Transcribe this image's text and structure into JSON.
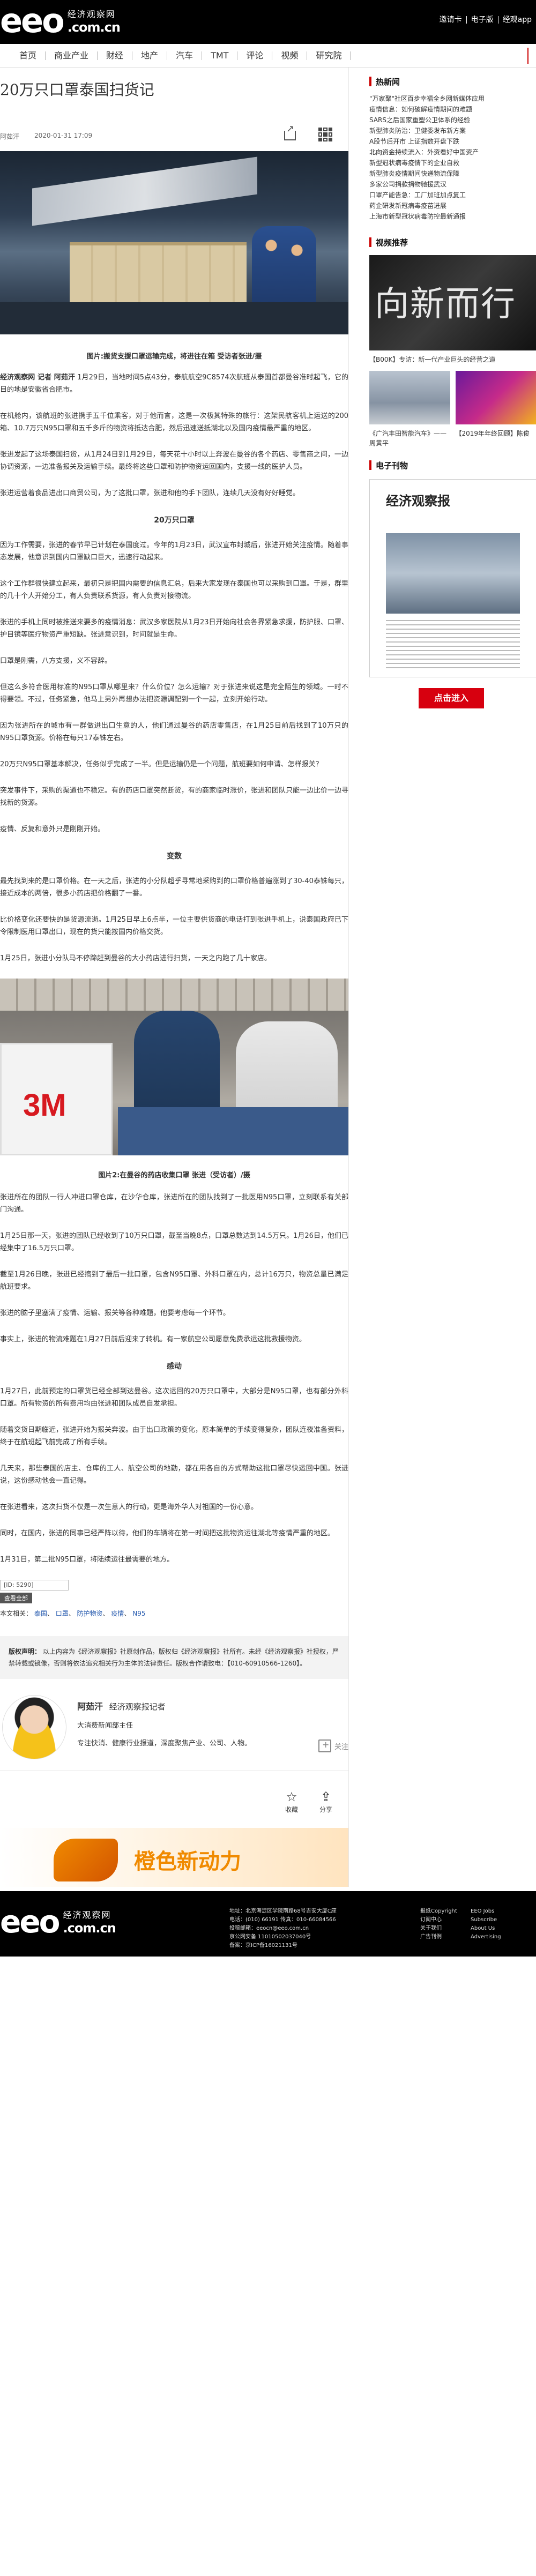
{
  "header": {
    "logo_eeo": "eeo",
    "logo_cn": "经济观察网",
    "logo_domain": ".com.cn",
    "top_links": [
      "邀请卡",
      "电子版",
      "经观app"
    ]
  },
  "nav": [
    "首页",
    "商业产业",
    "财经",
    "地产",
    "汽车",
    "TMT",
    "评论",
    "视频",
    "研究院"
  ],
  "article": {
    "title": "20万只口罩泰国扫货记",
    "author": "阿茹汗",
    "date": "2020-01-31 17:09",
    "caption1": "图片:搬货支援口罩运输完成，将进往在箱 受访者张进/摄",
    "paras1": [
      [
        "经济观察网 记者 阿茹汗",
        " 1月29日，当地时间5点43分，泰航航空9C8574次航班从泰国首都曼谷准时起飞，它的目的地是安徽省合肥市。"
      ],
      [
        "",
        "在机舱内，该航班的张进携手五千位乘客，对于他而言，这是一次极其特殊的旅行：这架民航客机上运送的200箱、10.7万只N95口罩和五千多斤的物资将抵达合肥，然后迅速送抵湖北以及国内疫情最严重的地区。"
      ],
      [
        "",
        "张进发起了这场泰国扫货，从1月24日到1月29日，每天花十小时以上奔波在曼谷的各个药店、零售商之间，一边协调资源，一边准备报关及运输手续。最终将这些口罩和防护物资运回国内，支援一线的医护人员。"
      ],
      [
        "",
        "张进运营着食品进出口商贸公司，为了这批口罩，张进和他的手下团队，连续几天没有好好睡觉。"
      ]
    ],
    "head1": "20万只口罩",
    "paras2": [
      [
        "",
        "因为工作需要，张进的春节早已计划在泰国度过。今年的1月23日，武汉宣布封城后，张进开始关注疫情。随着事态发展，他意识到国内口罩缺口巨大，迅速行动起来。"
      ],
      [
        "",
        "这个工作群很快建立起来，最初只是把国内需要的信息汇总，后来大家发现在泰国也可以采购到口罩。于是，群里的几十个人开始分工，有人负责联系货源，有人负责对接物流。"
      ],
      [
        "",
        "张进的手机上同时被推送来要多的疫情消息：武汉多家医院从1月23日开始向社会各界紧急求援，防护服、口罩、护目镜等医疗物资严重短缺。张进意识到，时间就是生命。"
      ],
      [
        "",
        "口罩是刚需，八方支援，义不容辞。"
      ],
      [
        "",
        "但这么多符合医用标准的N95口罩从哪里来？什么价位？怎么运输？对于张进来说这是完全陌生的领域。一时不得要领。不过，任务紧急，他马上另外再想办法把资源调配到一个一起，立刻开始行动。"
      ],
      [
        "",
        "因为张进所在的城市有一群做进出口生意的人，他们通过曼谷的药店零售店，在1月25日前后找到了10万只的N95口罩货源。价格在每只17泰铢左右。"
      ],
      [
        "",
        "20万只N95口罩基本解决，任务似乎完成了一半。但是运输仍是一个问题，航班要如何申请、怎样报关？"
      ],
      [
        "",
        "突发事件下，采购的渠道也不稳定。有的药店口罩突然断货，有的商家临时涨价，张进和团队只能一边比价一边寻找新的货源。"
      ],
      [
        "",
        "疫情、反复和意外只是刚刚开始。"
      ]
    ],
    "head2": "变数",
    "paras3": [
      [
        "",
        "最先找到来的是口罩价格。在一天之后，张进的小分队超乎寻常地采购到的口罩价格普遍涨到了30-40泰铢每只，接近成本的两倍，很多小药店把价格翻了一番。"
      ],
      [
        "",
        "比价格变化还要快的是货源流逝。1月25日早上6点半，一位主要供货商的电话打到张进手机上，说泰国政府已下令限制医用口罩出口，现在的货只能按国内价格交货。"
      ],
      [
        "",
        "1月25日，张进小分队马不停蹄赶到曼谷的大小药店进行扫货，一天之内跑了几十家店。"
      ]
    ],
    "caption2": "图片2:在曼谷的药店收集口罩 张进（受访者）/摄",
    "paras4": [
      [
        "",
        "张进所在的团队一行人冲进口罩仓库，在沙华仓库，张进所在的团队找到了一批医用N95口罩，立刻联系有关部门沟通。"
      ],
      [
        "",
        "1月25日那一天，张进的团队已经收到了10万只口罩，截至当晚8点，口罩总数达到14.5万只。1月26日，他们已经集中了16.5万只口罩。"
      ],
      [
        "",
        "截至1月26日晚，张进已经搞到了最后一批口罩，包含N95口罩、外科口罩在内，总计16万只，物资总量已满足航班要求。"
      ],
      [
        "",
        "张进的脑子里塞满了疫情、运输、报关等各种难题，他要考虑每一个环节。"
      ],
      [
        "",
        "事实上，张进的物流难题在1月27日前后迎来了转机。有一家航空公司愿意免费承运这批救援物资。"
      ]
    ],
    "head3": "感动",
    "paras5": [
      [
        "",
        "1月27日，此前预定的口罩货已经全部到达曼谷。这次运回的20万只口罩中，大部分是N95口罩，也有部分外科口罩。所有物资的所有费用均由张进和团队成员自发承担。"
      ],
      [
        "",
        "随着交货日期临近，张进开始为报关奔波。由于出口政策的变化，原本简单的手续变得复杂，团队连夜准备资料，终于在航班起飞前完成了所有手续。"
      ],
      [
        "",
        "几天来，那些泰国的店主、仓库的工人、航空公司的地勤，都在用各自的方式帮助这批口罩尽快运回中国。张进说，这份感动他会一直记得。"
      ],
      [
        "",
        "在张进看来，这次扫货不仅是一次生意人的行动，更是海外华人对祖国的一份心意。"
      ],
      [
        "",
        "同时，在国内，张进的同事已经严阵以待，他们的车辆将在第一时间把这批物资运往湖北等疫情严重的地区。"
      ],
      [
        "",
        "1月31日，第二批N95口罩，将陆续运往最需要的地方。"
      ]
    ],
    "source_box": "[ID: 5290]",
    "more_btn": "查看全部",
    "tags_prefix": "本文相关：",
    "tags": [
      "泰国",
      "口罩",
      "防护物资",
      "疫情",
      "N95"
    ],
    "copyright_title": "版权声明：",
    "copyright_text": "以上内容为《经济观察报》社原创作品，版权归《经济观察报》社所有。未经《经济观察报》社授权，严禁转载或镜像，否则将依法追究相关行为主体的法律责任。版权合作请致电：【010-60910566-1260】。"
  },
  "author_card": {
    "name": "阿茹汗",
    "role": "经济观察报记者",
    "line1": "大消费新闻部主任",
    "line2": "专注快消、健康行业报道，深度聚焦产业、公司、人物。",
    "follow": "关注"
  },
  "actions": {
    "save": "收藏",
    "share": "分享"
  },
  "banner_text": "橙色新动力",
  "sidebar": {
    "hot_title": "热新闻",
    "hot_items": [
      "\"万家聚\"社区百步幸福全乡网新媒体应用",
      "疫情信息：如何破解疫情期间的难题",
      "SARS之后国家重塑公卫体系的经验",
      "新型肺炎防治：卫健委发布新方案",
      "A股节后开市 上证指数开盘下跌",
      "北向资金持续流入：外资看好中国资产",
      "新型冠状病毒疫情下的企业自救",
      "新型肺炎疫情期间快递物流保障",
      "多家公司捐款捐物驰援武汉",
      "口罩产能告急：工厂加班加点复工",
      "药企研发新冠病毒疫苗进展",
      "上海市新型冠状病毒防控最新通报"
    ],
    "video_title": "视频推荐",
    "video_main_text": "向新而行",
    "video_main_cap": "【B00K】专访：新一代产业巨头的经营之道",
    "video_small": [
      {
        "cap": "",
        "text": "《广汽丰田智能汽车》——周黄平"
      },
      {
        "cap": "",
        "text": "【2019年年终回顾】陈俊"
      }
    ],
    "epaper_title": "电子刊物",
    "epaper_masthead": "经济观察报",
    "join_btn": "点击进入"
  },
  "footer": {
    "logo_eeo": "eeo",
    "logo_cn": "经济观察网",
    "logo_domain": ".com.cn",
    "mid_lines": [
      "地址：北京海淀区学院南路68号吉安大厦C座",
      "电话：(010) 66191 传真：010-66084566",
      "投稿邮箱：eeocn@eeo.com.cn",
      "京公网安备 11010502037040号",
      "备案：京ICP备16021131号"
    ],
    "right_links": [
      "报纸Copyright",
      "EEO Jobs",
      "订阅中心",
      "Subscribe",
      "关于我们",
      "About Us",
      "广告刊例",
      "Advertising"
    ]
  }
}
